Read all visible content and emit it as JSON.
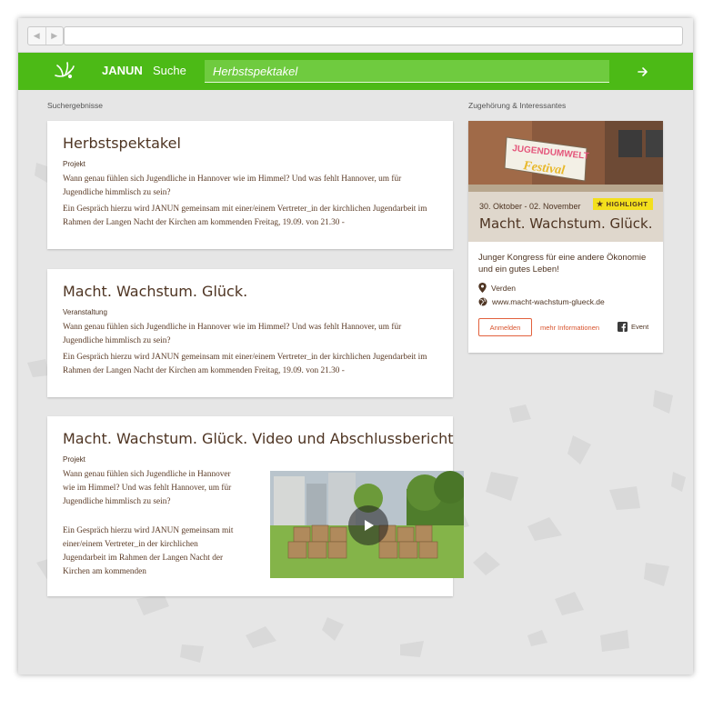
{
  "header": {
    "brand": "JANUN",
    "nav_search": "Suche",
    "search_value": "Herbstspektakel"
  },
  "labels": {
    "results": "Suchergebnisse",
    "related": "Zugehörung & Interessantes"
  },
  "results": [
    {
      "title": "Herbstspektakel",
      "type": "Projekt",
      "paragraphs": [
        "Wann genau fühlen sich Jugendliche in Hannover wie im Himmel? Und was fehlt Hannover, um für Jugendliche himmlisch zu sein?",
        "Ein Gespräch hierzu wird JANUN gemeinsam mit einer/einem Vertreter_in der kirchlichen Jugendarbeit im Rahmen der Langen Nacht der Kirchen am kommenden Freitag, 19.09. von 21.30 -"
      ]
    },
    {
      "title": "Macht. Wachstum. Glück.",
      "type": "Veranstaltung",
      "paragraphs": [
        "Wann genau fühlen sich Jugendliche in Hannover wie im Himmel? Und was fehlt Hannover, um für Jugendliche himmlisch zu sein?",
        "Ein Gespräch hierzu wird JANUN gemeinsam mit einer/einem Vertreter_in der kirchlichen Jugendarbeit im Rahmen der Langen Nacht der Kirchen am kommenden Freitag, 19.09. von 21.30 -"
      ]
    },
    {
      "title": "Macht. Wachstum. Glück. Video und Abschlussbericht",
      "type": "Projekt",
      "paragraphs": [
        "Wann genau fühlen sich Jugendliche in Hannover wie im Himmel? Und was fehlt Hannover, um für Jugendliche himmlisch zu sein?",
        "Ein Gespräch hierzu wird JANUN gemeinsam mit einer/einem Vertreter_in der kirchlichen Jugendarbeit im Rahmen der Langen Nacht der Kirchen am kommenden"
      ]
    }
  ],
  "sidebar": {
    "banner_text_1": "JUGENDUMWELT",
    "banner_text_2": "Festival",
    "badge": "HIGHLIGHT",
    "date": "30. Oktober - 02. November",
    "title": "Macht. Wachstum. Glück.",
    "description": "Junger Kongress für eine andere Ökonomie und ein gutes Leben!",
    "location": "Verden",
    "website": "www.macht-wachstum-glueck.de",
    "register_button": "Anmelden",
    "more_link": "mehr Informationen",
    "event_label": "Event"
  },
  "colors": {
    "brand_green": "#4cba16",
    "text_brown": "#4e3422",
    "accent_orange": "#d8532d",
    "highlight_yellow": "#f3df1c"
  }
}
